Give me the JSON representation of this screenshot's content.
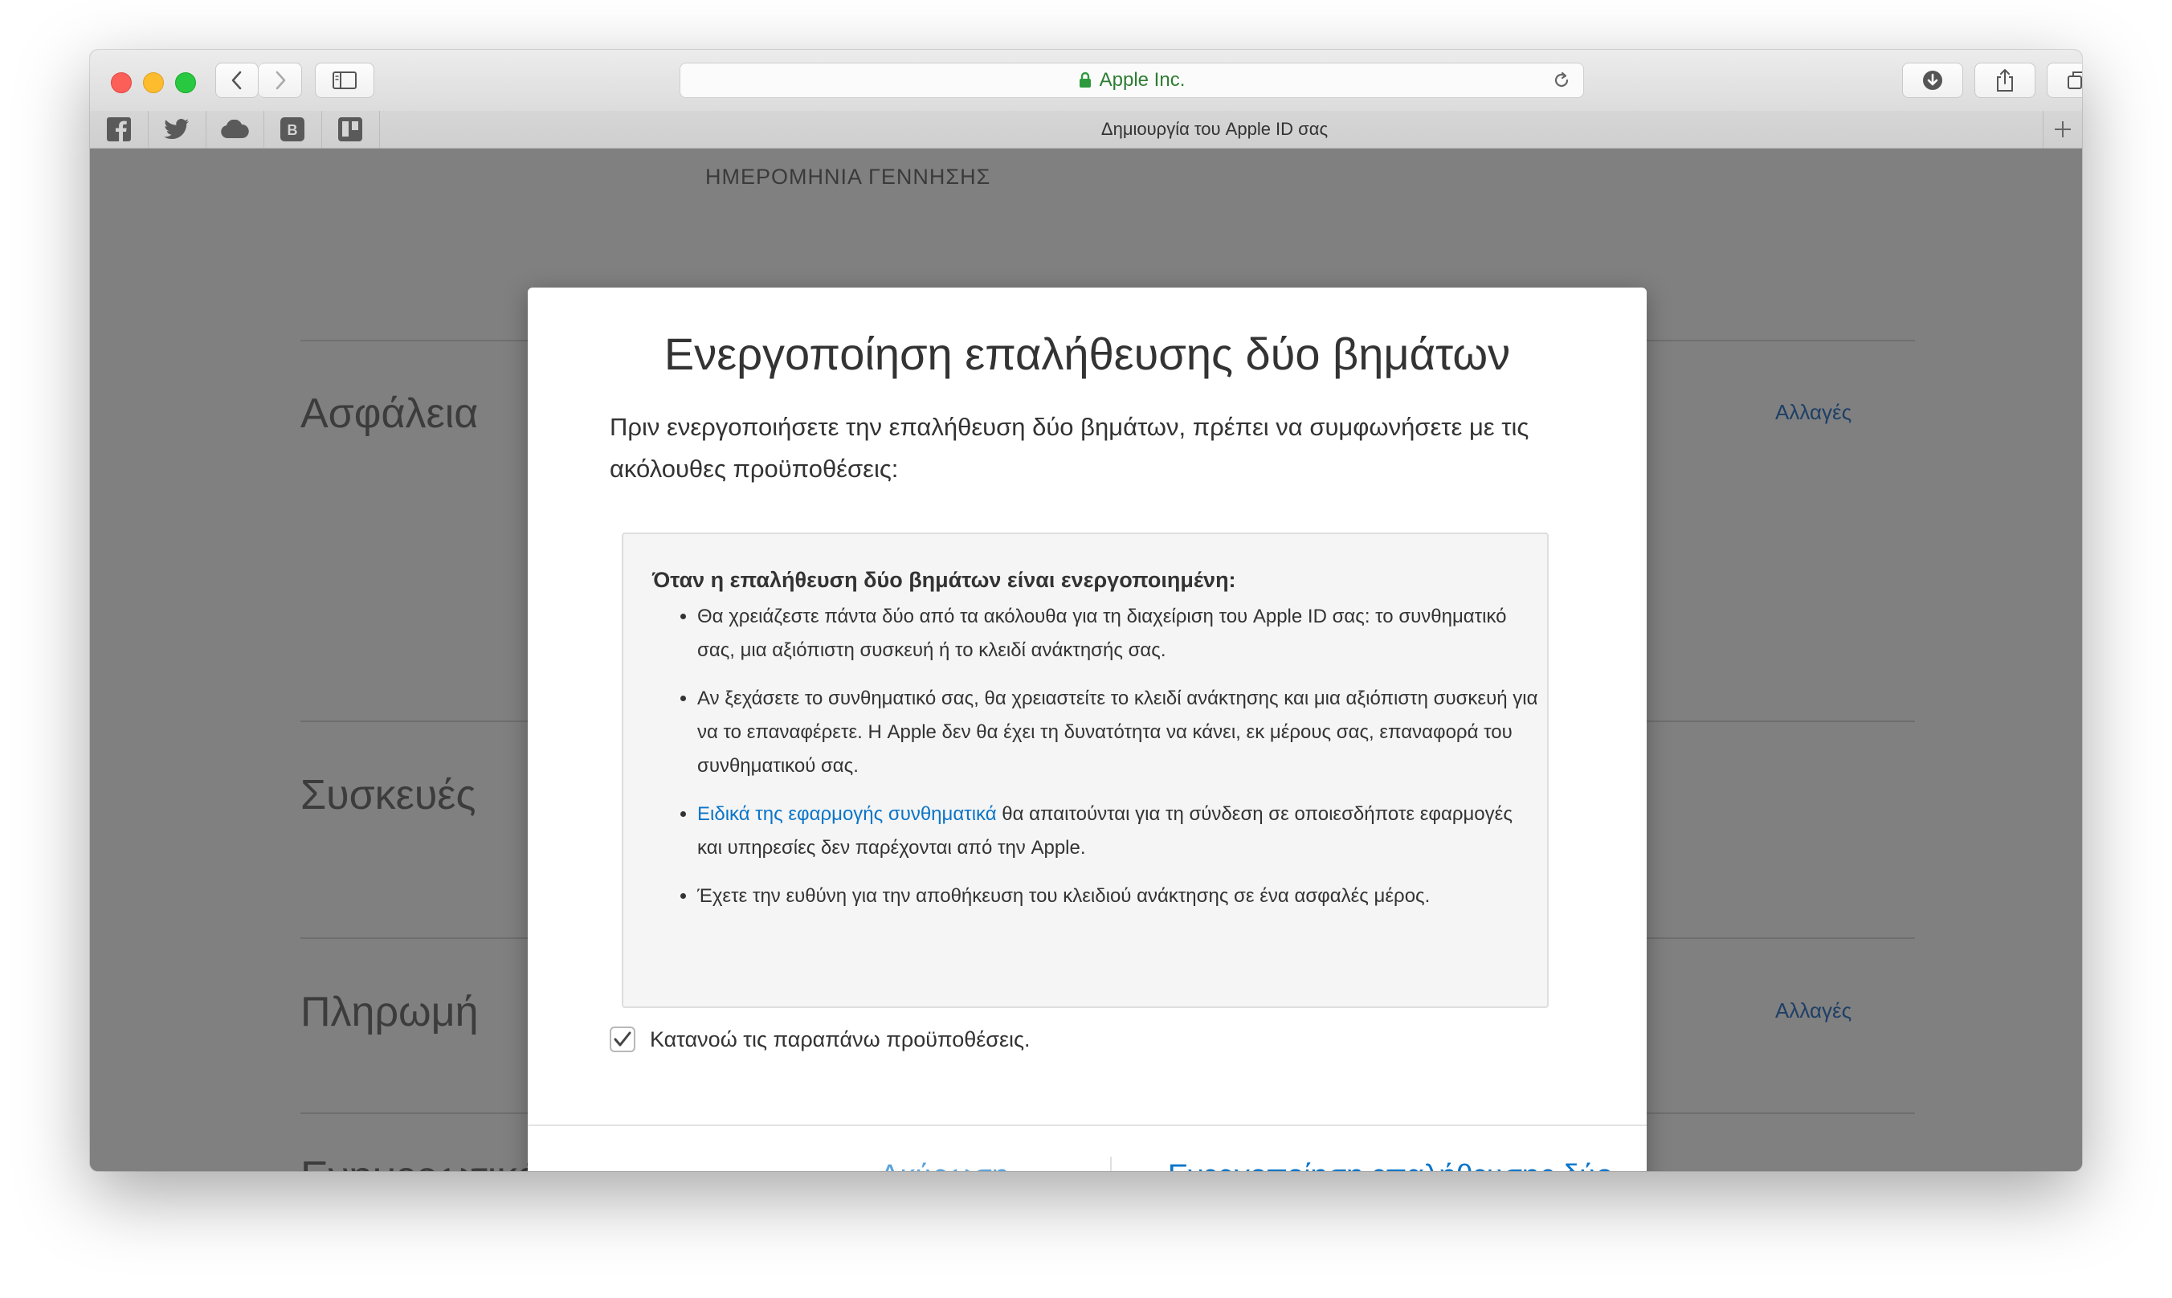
{
  "browser": {
    "address": "Apple Inc.",
    "tab_title": "Δημιουργία του Apple ID σας",
    "favorites": [
      "facebook-icon",
      "twitter-icon",
      "cloud-icon",
      "vk-icon",
      "trello-icon"
    ]
  },
  "background_page": {
    "dob_label": "ΗΜΕΡΟΜΗΝΙΑ ΓΕΝΝΗΣΗΣ",
    "sections": [
      {
        "title": "Ασφάλεια",
        "link": "Αλλαγές"
      },
      {
        "title": "Συσκευές",
        "link": ""
      },
      {
        "title": "Πληρωμή",
        "link": "Αλλαγές"
      },
      {
        "title": "Ενημερωτικά δελτία",
        "link": ""
      }
    ]
  },
  "modal": {
    "title": "Ενεργοποίηση επαλήθευσης δύο βημάτων",
    "intro": "Πριν ενεργοποιήσετε την επαλήθευση δύο βημάτων, πρέπει να συμφωνήσετε με τις ακόλουθες προϋποθέσεις:",
    "terms_heading": "Όταν η επαλήθευση δύο βημάτων είναι ενεργοποιημένη:",
    "terms": [
      {
        "text": "Θα χρειάζεστε πάντα δύο από τα ακόλουθα για τη διαχείριση του Apple ID σας: το συνθηματικό σας, μια αξιόπιστη συσκευή ή το κλειδί ανάκτησής σας."
      },
      {
        "text": "Αν ξεχάσετε το συνθηματικό σας, θα χρειαστείτε το κλειδί ανάκτησης και μια αξιόπιστη συσκευή για να το επαναφέρετε. Η Apple δεν θα έχει τη δυνατότητα να κάνει, εκ μέρους σας, επαναφορά του συνθηματικού σας."
      },
      {
        "link": "Ειδικά της εφαρμογής συνθηματικά",
        "text": " θα απαιτούνται για τη σύνδεση σε οποιεσδήποτε εφαρμογές και υπηρεσίες δεν παρέχονται από την Apple."
      },
      {
        "text": "Έχετε την ευθύνη για την αποθήκευση του κλειδιού ανάκτησης σε ένα ασφαλές μέρος."
      }
    ],
    "agree_label": "Κατανοώ τις παραπάνω προϋποθέσεις.",
    "agree_checked": true,
    "cancel_label": "Ακύρωση",
    "confirm_label": "Ενεργοποίηση επαλήθευσης δύο βημάτων",
    "accent_color": "#0a75c9"
  }
}
